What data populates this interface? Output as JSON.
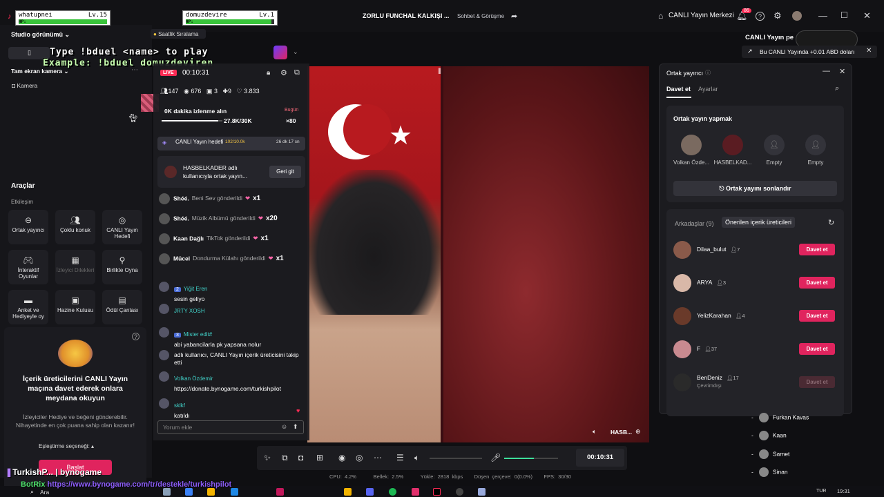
{
  "titlebar": {
    "center_title": "ZORLU FUNCHAL KALKIŞI ...",
    "tab2": "Sohbet & Görüşme",
    "live_center": "CANLI Yayın Merkezi",
    "notif_count": "86"
  },
  "game": {
    "player1_name": "whatupnei",
    "player1_level": "Lv.15",
    "player2_name": "domuzdevire",
    "player2_level": "Lv.1",
    "hp_label": "HP:",
    "player1_hp_fraction": 1.0,
    "player2_hp_fraction": 0.97,
    "line1": "Type !bduel <name> to play",
    "line2": "Example: !bduel domuzdeviren"
  },
  "left": {
    "studio_view": "Studio görünümü",
    "ranking": "Saatlik Sıralama",
    "fullscreen_camera": "Tam ekran kamera",
    "camera": "Kamera",
    "tools_title": "Araçlar",
    "interaction": "Etkileşim",
    "tools": [
      {
        "label": "Ortak yayıncı",
        "icon": "link-icon"
      },
      {
        "label": "Çoklu konuk",
        "icon": "users-icon"
      },
      {
        "label": "CANLI Yayın Hedefi",
        "icon": "target-icon"
      },
      {
        "label": "İnteraktif Oyunlar",
        "icon": "gamepad-icon"
      },
      {
        "label": "İzleyici Dilekleri",
        "icon": "gift-icon"
      },
      {
        "label": "Birlikte Oyna",
        "icon": "joystick-icon"
      },
      {
        "label": "Anket ve Hediyeyle oy",
        "icon": "poll-icon"
      },
      {
        "label": "Hazine Kutusu",
        "icon": "chest-icon"
      },
      {
        "label": "Ödül Çantası",
        "icon": "bag-icon"
      }
    ],
    "promo_title": "İçerik üreticilerini CANLI Yayın maçına davet ederek onlara meydana okuyun",
    "promo_text": "İzleyiciler Hediye ve beğeni gönderebilir. Nihayetinde en çok puana sahip olan kazanır!",
    "matching_pref": "Eşleştirme seçeneği:",
    "start_button": "Başlat",
    "overlay_brand": "TurkishP... | bynogame",
    "overlay_link": "https://www.bynogame.com/tr/destekle/turkishpilot",
    "overlay_bot": "BotRix"
  },
  "live": {
    "badge": "LIVE",
    "time": "00:10:31",
    "stats": [
      "147",
      "676",
      "3",
      "9",
      "3.833"
    ],
    "goal_title": "0K dakika izlenme alın",
    "goal_today": "Bugün",
    "goal_progress": "27.8K/30K",
    "goal_fraction": 0.93,
    "goal_multiplier": "×80",
    "live_goal": "CANLI Yayın hedefi",
    "live_goal_count": "102/10.0k",
    "live_goal_time": "26 dk 17 sn",
    "cohost_notice": "HASBELKADER adlı kullanıcıyla ortak yayın...",
    "back_button": "Geri git",
    "gifts": [
      {
        "user": "Shéé.",
        "text": "Beni Sev gönderildi",
        "count": "x1"
      },
      {
        "user": "Shéé.",
        "text": "Müzik Albümü gönderildi",
        "count": "x20"
      },
      {
        "user": "Kaan Dağlı",
        "text": "TikTok gönderildi",
        "count": "x1"
      },
      {
        "user": "Mücel",
        "text": "Dondurma Külahı gönderildi",
        "count": "x1"
      }
    ],
    "chats": [
      {
        "level": "2",
        "user": "Yiğit Eren",
        "msg": "sesin geliyo"
      },
      {
        "level": "",
        "user": "JRTY XOSH",
        "msg": ""
      },
      {
        "level": "3",
        "user": "Mister edit#",
        "msg": "abi yabancilarla pk yapsana nolur"
      },
      {
        "level": "",
        "user": "",
        "msg": "adlı kullanıcı, CANLI Yayın içerik üreticisini takip etti"
      },
      {
        "level": "",
        "user": "Volkan Özdemir",
        "msg": "https://donate.bynogame.com/turkishpilot"
      },
      {
        "level": "",
        "user": "sklkf",
        "msg": "katıldı"
      }
    ],
    "comment_placeholder": "Yorum ekle"
  },
  "cohost": {
    "title": "Ortak yayıncı",
    "tab_invite": "Davet et",
    "tab_settings": "Ayarlar",
    "section": "Ortak yayın yapmak",
    "slots": [
      "Volkan Özde...",
      "HASBELKAD...",
      "Empty",
      "Empty"
    ],
    "end_button": "Ortak yayını sonlandır",
    "friends_tab": "Arkadaşlar (9)",
    "suggested_tab": "Önerilen içerik üreticileri",
    "friends": [
      {
        "name": "Dilaa_bulut",
        "count": "7",
        "action": "Davet et",
        "disabled": false
      },
      {
        "name": "ARYA",
        "count": "3",
        "action": "Davet et",
        "disabled": false
      },
      {
        "name": "YelizKarahan",
        "count": "4",
        "action": "Davet et",
        "disabled": false
      },
      {
        "name": "F",
        "count": "37",
        "action": "Davet et",
        "disabled": false
      },
      {
        "name": "BenDeniz",
        "count": "17",
        "status": "Çevrimdışı",
        "action": "Davet et",
        "disabled": true
      }
    ]
  },
  "side": {
    "live_short": "CANLI Yayın pe",
    "earn_text": "Bu CANLI Yayında +0.01 ABD doları",
    "viewers": [
      "Furkan Kavas",
      "Kaan",
      "Samet",
      "Sinan"
    ]
  },
  "video": {
    "guest_label": "HASB..."
  },
  "toolbar": {
    "time": "00:10:31",
    "mic_level": 0.55
  },
  "status": {
    "cpu": "CPU: 4.2%",
    "mem": "Bellek: 2.5%",
    "upload": "Yükle: 2818 kbps",
    "dropped": "Düşen çerçeve: 0(0.0%)",
    "fps": "FPS: 30/30"
  },
  "taskbar": {
    "search": "Ara",
    "lang": "TUR",
    "clock": "19:31"
  }
}
